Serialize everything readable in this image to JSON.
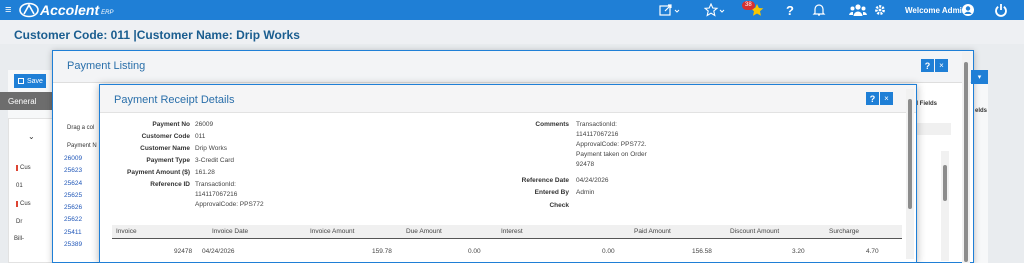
{
  "topbar": {
    "brand": "Accolent",
    "brand_suffix": "ERP",
    "notification_count": "38",
    "welcome": "Welcome Admin"
  },
  "page": {
    "title": "Customer  Code: 011 |Customer Name: Drip Works"
  },
  "background": {
    "save_label": "Save",
    "general_tab": "General",
    "drag_hint": "Drag a col",
    "payment_col": "Payment N",
    "cust_labels": [
      "Cus",
      "01",
      "Cus",
      "Dr",
      "Bill-"
    ],
    "right_labels": [
      "ed Fields",
      "elds"
    ]
  },
  "payment_listing": {
    "title": "Payment Listing",
    "help_label": "?",
    "close_label": "×",
    "payment_ids": [
      "26009",
      "25623",
      "25624",
      "25625",
      "25626",
      "25622",
      "25411",
      "25389"
    ]
  },
  "receipt": {
    "title": "Payment Receipt Details",
    "help_label": "?",
    "close_label": "×",
    "left_fields": [
      {
        "label": "Payment No",
        "value": "26009"
      },
      {
        "label": "Customer Code",
        "value": "011"
      },
      {
        "label": "Customer Name",
        "value": "Drip Works"
      },
      {
        "label": "Payment Type",
        "value": "3-Credit Card"
      },
      {
        "label": "Payment Amount ($)",
        "value": "161.28"
      },
      {
        "label": "Reference ID",
        "value_lines": [
          "TransactionId:",
          "114117067216",
          "ApprovalCode: PPS772"
        ]
      }
    ],
    "right_fields": [
      {
        "label": "Comments",
        "value_lines": [
          "TransactionId:",
          "114117067216",
          "ApprovalCode: PPS772.",
          "Payment taken on Order",
          "92478"
        ]
      },
      {
        "label": "Reference Date",
        "value": "04/24/2026"
      },
      {
        "label": "Entered By",
        "value": "Admin"
      },
      {
        "label": "Check",
        "value": ""
      }
    ],
    "invoice_columns": [
      "Invoice",
      "Invoice Date",
      "Invoice Amount",
      "Due Amount",
      "Interest",
      "Paid Amount",
      "Discount Amount",
      "Surcharge"
    ],
    "invoice_rows": [
      {
        "invoice": "92478",
        "date": "04/24/2026",
        "amount": "159.78",
        "due": "0.00",
        "interest": "0.00",
        "paid": "156.58",
        "discount": "3.20",
        "surcharge": "4.70"
      }
    ]
  }
}
